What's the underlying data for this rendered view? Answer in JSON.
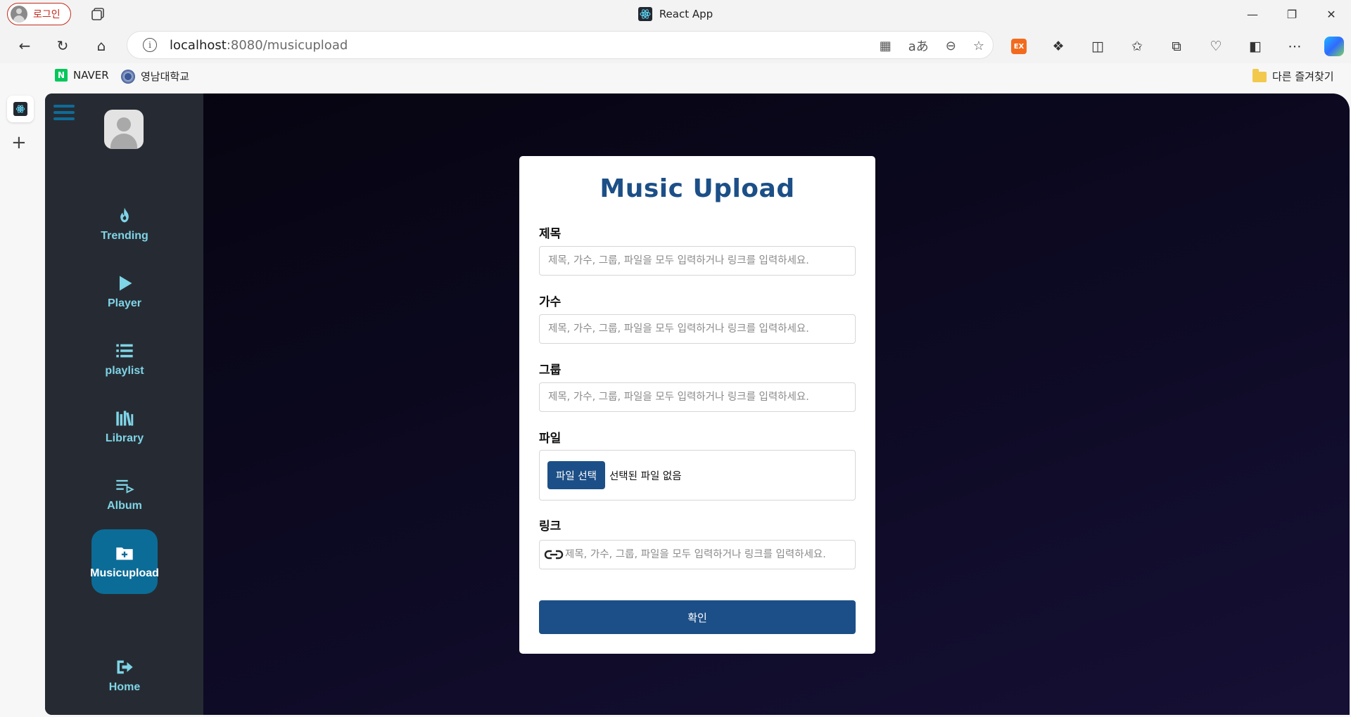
{
  "browser": {
    "profile_label": "로그인",
    "window_title": "React App",
    "url_host": "localhost",
    "url_path": ":8080/musicupload",
    "favorites": [
      {
        "label": "NAVER"
      },
      {
        "label": "영남대학교"
      }
    ],
    "other_favorites_label": "다른 즐겨찾기",
    "extension_badge": "EX"
  },
  "sidebar": {
    "items": [
      {
        "label": "Trending",
        "icon": "fire-icon"
      },
      {
        "label": "Player",
        "icon": "play-icon"
      },
      {
        "label": "playlist",
        "icon": "list-icon"
      },
      {
        "label": "Library",
        "icon": "library-icon"
      },
      {
        "label": "Album",
        "icon": "queue-music-icon"
      },
      {
        "label": "Musicupload",
        "icon": "folder-upload-icon",
        "active": true
      }
    ],
    "home_label": "Home",
    "accent_color": "#0b6c97",
    "label_color": "#7fd4e6"
  },
  "upload_form": {
    "title": "Music Upload",
    "title_label": "제목",
    "title_placeholder": "제목, 가수, 그룹, 파일을 모두 입력하거나 링크를 입력하세요.",
    "artist_label": "가수",
    "artist_placeholder": "제목, 가수, 그룹, 파일을 모두 입력하거나 링크를 입력하세요.",
    "group_label": "그룹",
    "group_placeholder": "제목, 가수, 그룹, 파일을 모두 입력하거나 링크를 입력하세요.",
    "file_label": "파일",
    "file_button": "파일 선택",
    "file_status": "선택된 파일 없음",
    "link_label": "링크",
    "link_placeholder": "제목, 가수, 그룹, 파일을 모두 입력하거나 링크를 입력하세요.",
    "submit_label": "확인",
    "primary_color": "#1c4f87"
  }
}
